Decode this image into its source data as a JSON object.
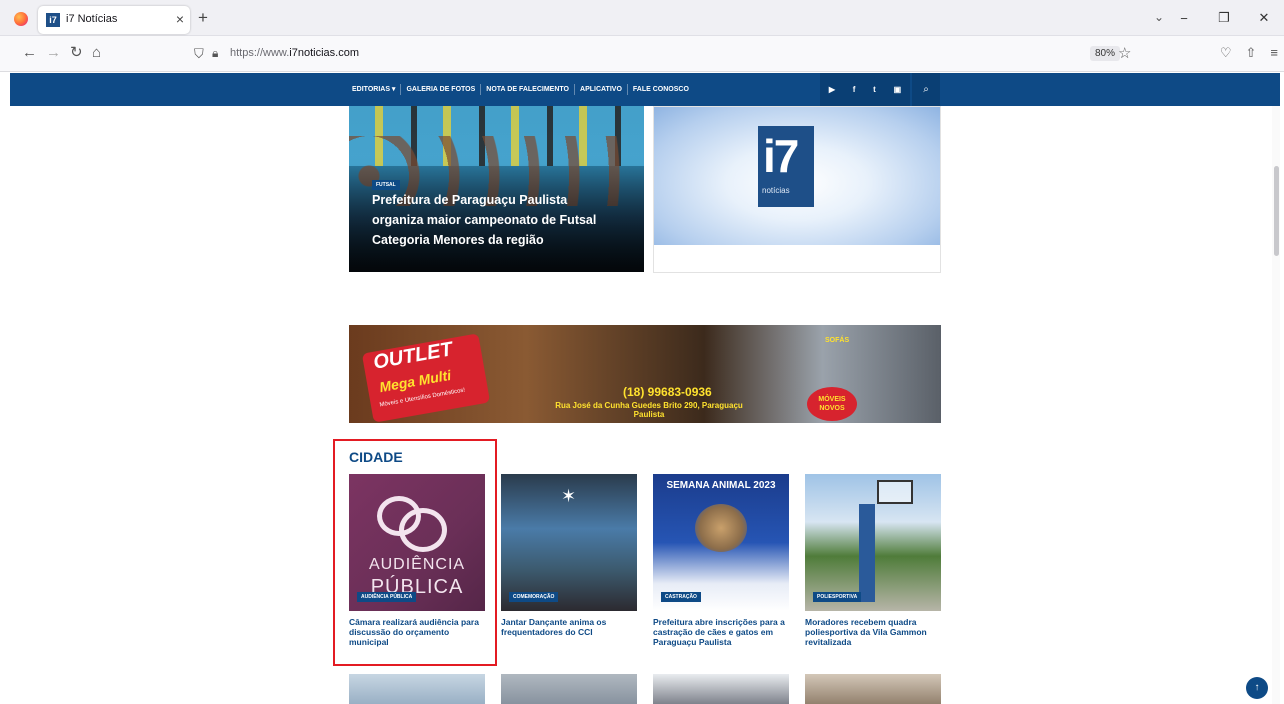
{
  "browser": {
    "tab_title": "i7 Notícias",
    "tab_favicon": "i7",
    "url_prefix": "https://www.",
    "url_domain": "i7noticias.com",
    "zoom": "80%"
  },
  "site": {
    "menu": [
      "EDITORIAS ▾",
      "GALERIA DE FOTOS",
      "NOTA DE FALECIMENTO",
      "APLICATIVO",
      "FALE CONOSCO"
    ],
    "social": [
      "▶",
      "f",
      "t",
      "▣"
    ]
  },
  "hero": {
    "category": "FUTSAL",
    "title": "Prefeitura de Paraguaçu Paulista organiza maior campeonato de Futsal Categoria Menores da região",
    "logo_big": "i7",
    "logo_small": "notícias"
  },
  "ad": {
    "outlet": "OUTLET",
    "mega": "Mega Multi",
    "tagline": "Móveis e Utensílios Domésticos!",
    "phone": "(18) 99683-0936",
    "address": "Rua José da Cunha Guedes Brito 290, Paraguaçu Paulista",
    "sofas": "SOFÁS",
    "novos": "MÓVEIS NOVOS"
  },
  "section": {
    "title": "CIDADE",
    "cards": [
      {
        "category": "AUDIÊNCIA PÚBLICA",
        "title": "Câmara realizará audiência para discussão do orçamento municipal",
        "img_text1": "AUDIÊNCIA",
        "img_text2": "PÚBLICA"
      },
      {
        "category": "COMEMORAÇÃO",
        "title": "Jantar Dançante anima os frequentadores do CCI"
      },
      {
        "category": "CASTRAÇÃO",
        "title": "Prefeitura abre inscrições para a castração de cães e gatos em Paraguaçu Paulista",
        "img_text1": "SEMANA ANIMAL 2023"
      },
      {
        "category": "POLIESPORTIVA",
        "title": "Moradores recebem quadra poliesportiva da Vila Gammon revitalizada"
      }
    ]
  },
  "colors": {
    "brand": "#0e4a86",
    "highlight": "#e31b23"
  }
}
